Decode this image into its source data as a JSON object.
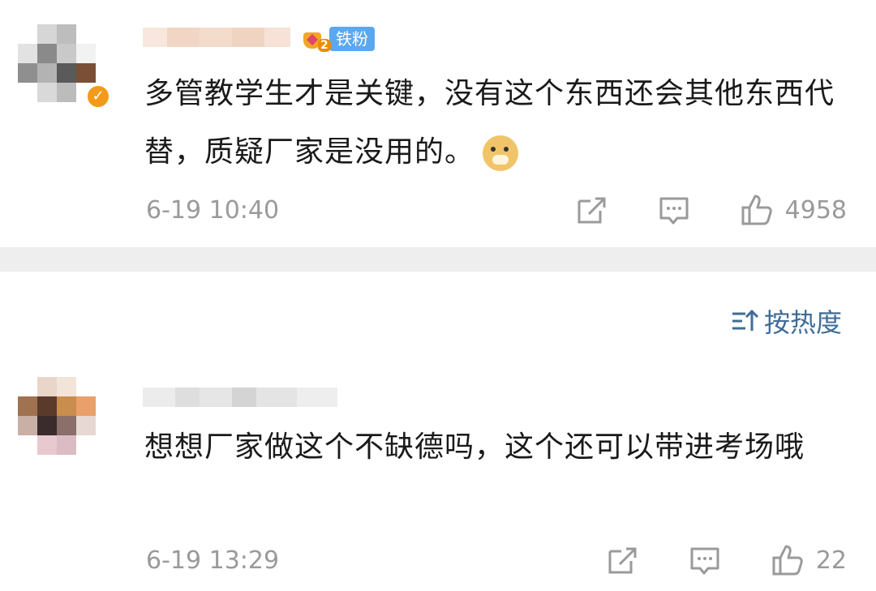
{
  "comments": [
    {
      "fan_badge": "铁粉",
      "fan_level": "2",
      "text": "多管教学生才是关键，没有这个东西还会其他东西代替，质疑厂家是没用的。",
      "emoji": "doge-emoji",
      "time": "6-19 10:40",
      "likes": "4958"
    },
    {
      "text": "想想厂家做这个不缺德吗，这个还可以带进考场哦",
      "time": "6-19 13:29",
      "likes": "22"
    }
  ],
  "sort": {
    "label": "按热度",
    "icon": "sort-icon"
  },
  "icons": {
    "share": "share-icon",
    "comment": "comment-icon",
    "like": "thumbs-up-icon",
    "verified": "verified-badge-icon"
  },
  "colors": {
    "timestamp": "#9a9a9a",
    "sort_link": "#3f6c98",
    "fan_badge": "#5aa8f0",
    "verified": "#f49a1a",
    "divider": "#eeeeee"
  }
}
